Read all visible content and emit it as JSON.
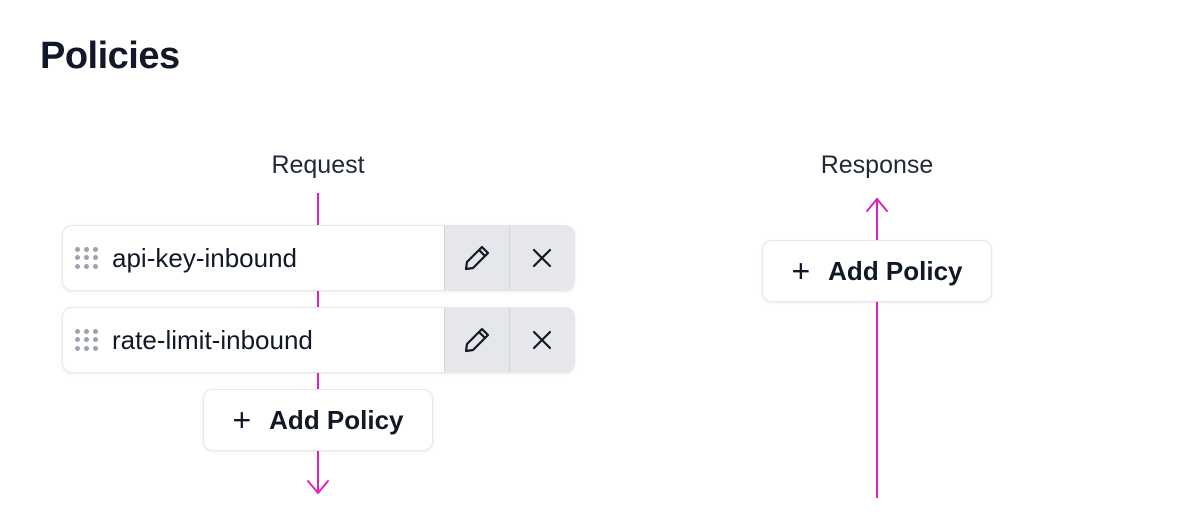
{
  "page": {
    "title": "Policies"
  },
  "request": {
    "label": "Request",
    "policies": [
      {
        "name": "api-key-inbound"
      },
      {
        "name": "rate-limit-inbound"
      }
    ],
    "add_label": "Add Policy"
  },
  "response": {
    "label": "Response",
    "add_label": "Add Policy"
  },
  "icons": {
    "add": "plus-icon",
    "edit": "pencil-icon",
    "remove": "close-icon",
    "drag": "drag-handle-icon",
    "flow_down": "arrow-down-icon",
    "flow_up": "arrow-up-icon"
  },
  "colors": {
    "flow_line": "#e11fbf",
    "button_bg": "#e5e7eb"
  }
}
